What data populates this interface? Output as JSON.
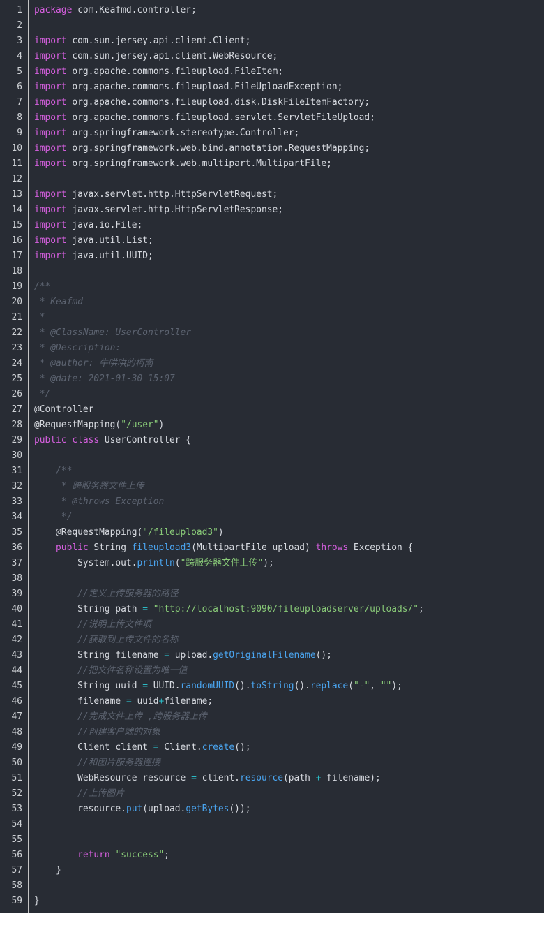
{
  "editor": {
    "language": "java",
    "colors": {
      "background": "#282c34",
      "plain": "#d7dae0",
      "keyword": "#d55fde",
      "comment": "#5c6370",
      "string": "#89ca78",
      "func": "#4aa5f0",
      "op": "#2bbac5",
      "gutter_divider": "#c5c5c5"
    },
    "lines": [
      {
        "n": "1",
        "tokens": [
          [
            "keyword",
            "package"
          ],
          [
            "plain",
            " com.Keafmd.controller;"
          ]
        ]
      },
      {
        "n": "2",
        "tokens": []
      },
      {
        "n": "3",
        "tokens": [
          [
            "keyword",
            "import"
          ],
          [
            "plain",
            " com.sun.jersey.api.client.Client;"
          ]
        ]
      },
      {
        "n": "4",
        "tokens": [
          [
            "keyword",
            "import"
          ],
          [
            "plain",
            " com.sun.jersey.api.client.WebResource;"
          ]
        ]
      },
      {
        "n": "5",
        "tokens": [
          [
            "keyword",
            "import"
          ],
          [
            "plain",
            " org.apache.commons.fileupload.FileItem;"
          ]
        ]
      },
      {
        "n": "6",
        "tokens": [
          [
            "keyword",
            "import"
          ],
          [
            "plain",
            " org.apache.commons.fileupload.FileUploadException;"
          ]
        ]
      },
      {
        "n": "7",
        "tokens": [
          [
            "keyword",
            "import"
          ],
          [
            "plain",
            " org.apache.commons.fileupload.disk.DiskFileItemFactory;"
          ]
        ]
      },
      {
        "n": "8",
        "tokens": [
          [
            "keyword",
            "import"
          ],
          [
            "plain",
            " org.apache.commons.fileupload.servlet.ServletFileUpload;"
          ]
        ]
      },
      {
        "n": "9",
        "tokens": [
          [
            "keyword",
            "import"
          ],
          [
            "plain",
            " org.springframework.stereotype.Controller;"
          ]
        ]
      },
      {
        "n": "10",
        "tokens": [
          [
            "keyword",
            "import"
          ],
          [
            "plain",
            " org.springframework.web.bind.annotation.RequestMapping;"
          ]
        ]
      },
      {
        "n": "11",
        "tokens": [
          [
            "keyword",
            "import"
          ],
          [
            "plain",
            " org.springframework.web.multipart.MultipartFile;"
          ]
        ]
      },
      {
        "n": "12",
        "tokens": []
      },
      {
        "n": "13",
        "tokens": [
          [
            "keyword",
            "import"
          ],
          [
            "plain",
            " javax.servlet.http.HttpServletRequest;"
          ]
        ]
      },
      {
        "n": "14",
        "tokens": [
          [
            "keyword",
            "import"
          ],
          [
            "plain",
            " javax.servlet.http.HttpServletResponse;"
          ]
        ]
      },
      {
        "n": "15",
        "tokens": [
          [
            "keyword",
            "import"
          ],
          [
            "plain",
            " java.io.File;"
          ]
        ]
      },
      {
        "n": "16",
        "tokens": [
          [
            "keyword",
            "import"
          ],
          [
            "plain",
            " java.util.List;"
          ]
        ]
      },
      {
        "n": "17",
        "tokens": [
          [
            "keyword",
            "import"
          ],
          [
            "plain",
            " java.util.UUID;"
          ]
        ]
      },
      {
        "n": "18",
        "tokens": []
      },
      {
        "n": "19",
        "tokens": [
          [
            "comment",
            "/**"
          ]
        ]
      },
      {
        "n": "20",
        "tokens": [
          [
            "comment",
            " * Keafmd"
          ]
        ]
      },
      {
        "n": "21",
        "tokens": [
          [
            "comment",
            " *"
          ]
        ]
      },
      {
        "n": "22",
        "tokens": [
          [
            "comment",
            " * @ClassName: UserController"
          ]
        ]
      },
      {
        "n": "23",
        "tokens": [
          [
            "comment",
            " * @Description:"
          ]
        ]
      },
      {
        "n": "24",
        "tokens": [
          [
            "comment",
            " * @author: 牛哄哄的柯南"
          ]
        ]
      },
      {
        "n": "25",
        "tokens": [
          [
            "comment",
            " * @date: 2021-01-30 15:07"
          ]
        ]
      },
      {
        "n": "26",
        "tokens": [
          [
            "comment",
            " */"
          ]
        ]
      },
      {
        "n": "27",
        "tokens": [
          [
            "annotation",
            "@Controller"
          ]
        ]
      },
      {
        "n": "28",
        "tokens": [
          [
            "annotation",
            "@RequestMapping("
          ],
          [
            "string",
            "\"/user\""
          ],
          [
            "plain",
            ")"
          ]
        ]
      },
      {
        "n": "29",
        "tokens": [
          [
            "keyword",
            "public"
          ],
          [
            "plain",
            " "
          ],
          [
            "keyword",
            "class"
          ],
          [
            "plain",
            " UserController {"
          ]
        ]
      },
      {
        "n": "30",
        "tokens": []
      },
      {
        "n": "31",
        "tokens": [
          [
            "plain",
            "    "
          ],
          [
            "comment",
            "/**"
          ]
        ]
      },
      {
        "n": "32",
        "tokens": [
          [
            "plain",
            "    "
          ],
          [
            "comment",
            " * 跨服务器文件上传"
          ]
        ]
      },
      {
        "n": "33",
        "tokens": [
          [
            "plain",
            "    "
          ],
          [
            "comment",
            " * @throws Exception"
          ]
        ]
      },
      {
        "n": "34",
        "tokens": [
          [
            "plain",
            "    "
          ],
          [
            "comment",
            " */"
          ]
        ]
      },
      {
        "n": "35",
        "tokens": [
          [
            "plain",
            "    "
          ],
          [
            "annotation",
            "@RequestMapping("
          ],
          [
            "string",
            "\"/fileupload3\""
          ],
          [
            "plain",
            ")"
          ]
        ]
      },
      {
        "n": "36",
        "tokens": [
          [
            "plain",
            "    "
          ],
          [
            "keyword",
            "public"
          ],
          [
            "plain",
            " String "
          ],
          [
            "func",
            "fileupload3"
          ],
          [
            "plain",
            "(MultipartFile upload) "
          ],
          [
            "keyword",
            "throws"
          ],
          [
            "plain",
            " Exception {"
          ]
        ]
      },
      {
        "n": "37",
        "tokens": [
          [
            "plain",
            "        System.out."
          ],
          [
            "func",
            "println"
          ],
          [
            "plain",
            "("
          ],
          [
            "string",
            "\"跨服务器文件上传\""
          ],
          [
            "plain",
            ");"
          ]
        ]
      },
      {
        "n": "38",
        "tokens": []
      },
      {
        "n": "39",
        "tokens": [
          [
            "plain",
            "        "
          ],
          [
            "comment",
            "//定义上传服务器的路径"
          ]
        ]
      },
      {
        "n": "40",
        "tokens": [
          [
            "plain",
            "        String path "
          ],
          [
            "op",
            "="
          ],
          [
            "plain",
            " "
          ],
          [
            "string",
            "\"http://localhost:9090/fileuploadserver/uploads/\""
          ],
          [
            "plain",
            ";"
          ]
        ]
      },
      {
        "n": "41",
        "tokens": [
          [
            "plain",
            "        "
          ],
          [
            "comment",
            "//说明上传文件项"
          ]
        ]
      },
      {
        "n": "42",
        "tokens": [
          [
            "plain",
            "        "
          ],
          [
            "comment",
            "//获取到上传文件的名称"
          ]
        ]
      },
      {
        "n": "43",
        "tokens": [
          [
            "plain",
            "        String filename "
          ],
          [
            "op",
            "="
          ],
          [
            "plain",
            " upload."
          ],
          [
            "func",
            "getOriginalFilename"
          ],
          [
            "plain",
            "();"
          ]
        ]
      },
      {
        "n": "44",
        "tokens": [
          [
            "plain",
            "        "
          ],
          [
            "comment",
            "//把文件名称设置为唯一值"
          ]
        ]
      },
      {
        "n": "45",
        "tokens": [
          [
            "plain",
            "        String uuid "
          ],
          [
            "op",
            "="
          ],
          [
            "plain",
            " UUID."
          ],
          [
            "func",
            "randomUUID"
          ],
          [
            "plain",
            "()."
          ],
          [
            "func",
            "toString"
          ],
          [
            "plain",
            "()."
          ],
          [
            "func",
            "replace"
          ],
          [
            "plain",
            "("
          ],
          [
            "string",
            "\"-\""
          ],
          [
            "plain",
            ", "
          ],
          [
            "string",
            "\"\""
          ],
          [
            "plain",
            ");"
          ]
        ]
      },
      {
        "n": "46",
        "tokens": [
          [
            "plain",
            "        filename "
          ],
          [
            "op",
            "="
          ],
          [
            "plain",
            " uuid"
          ],
          [
            "op",
            "+"
          ],
          [
            "plain",
            "filename;"
          ]
        ]
      },
      {
        "n": "47",
        "tokens": [
          [
            "plain",
            "        "
          ],
          [
            "comment",
            "//完成文件上传 ,跨服务器上传"
          ]
        ]
      },
      {
        "n": "48",
        "tokens": [
          [
            "plain",
            "        "
          ],
          [
            "comment",
            "//创建客户端的对象"
          ]
        ]
      },
      {
        "n": "49",
        "tokens": [
          [
            "plain",
            "        Client client "
          ],
          [
            "op",
            "="
          ],
          [
            "plain",
            " Client."
          ],
          [
            "func",
            "create"
          ],
          [
            "plain",
            "();"
          ]
        ]
      },
      {
        "n": "50",
        "tokens": [
          [
            "plain",
            "        "
          ],
          [
            "comment",
            "//和图片服务器连接"
          ]
        ]
      },
      {
        "n": "51",
        "tokens": [
          [
            "plain",
            "        WebResource resource "
          ],
          [
            "op",
            "="
          ],
          [
            "plain",
            " client."
          ],
          [
            "func",
            "resource"
          ],
          [
            "plain",
            "(path "
          ],
          [
            "op",
            "+"
          ],
          [
            "plain",
            " filename);"
          ]
        ]
      },
      {
        "n": "52",
        "tokens": [
          [
            "plain",
            "        "
          ],
          [
            "comment",
            "//上传图片"
          ]
        ]
      },
      {
        "n": "53",
        "tokens": [
          [
            "plain",
            "        resource."
          ],
          [
            "func",
            "put"
          ],
          [
            "plain",
            "(upload."
          ],
          [
            "func",
            "getBytes"
          ],
          [
            "plain",
            "());"
          ]
        ]
      },
      {
        "n": "54",
        "tokens": []
      },
      {
        "n": "55",
        "tokens": []
      },
      {
        "n": "56",
        "tokens": [
          [
            "plain",
            "        "
          ],
          [
            "keyword",
            "return"
          ],
          [
            "plain",
            " "
          ],
          [
            "string",
            "\"success\""
          ],
          [
            "plain",
            ";"
          ]
        ]
      },
      {
        "n": "57",
        "tokens": [
          [
            "plain",
            "    }"
          ]
        ]
      },
      {
        "n": "58",
        "tokens": []
      },
      {
        "n": "59",
        "tokens": [
          [
            "plain",
            "}"
          ]
        ]
      }
    ]
  }
}
